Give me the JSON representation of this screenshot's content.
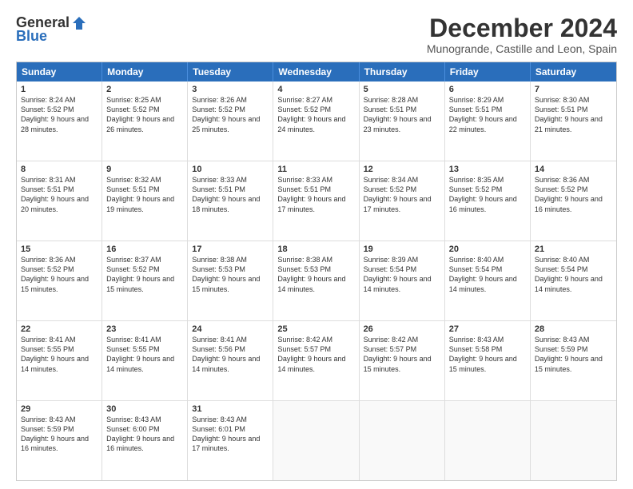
{
  "logo": {
    "general": "General",
    "blue": "Blue"
  },
  "title": "December 2024",
  "subtitle": "Munogrande, Castille and Leon, Spain",
  "days": [
    "Sunday",
    "Monday",
    "Tuesday",
    "Wednesday",
    "Thursday",
    "Friday",
    "Saturday"
  ],
  "weeks": [
    [
      {
        "day": "1",
        "sunrise": "Sunrise: 8:24 AM",
        "sunset": "Sunset: 5:52 PM",
        "daylight": "Daylight: 9 hours and 28 minutes."
      },
      {
        "day": "2",
        "sunrise": "Sunrise: 8:25 AM",
        "sunset": "Sunset: 5:52 PM",
        "daylight": "Daylight: 9 hours and 26 minutes."
      },
      {
        "day": "3",
        "sunrise": "Sunrise: 8:26 AM",
        "sunset": "Sunset: 5:52 PM",
        "daylight": "Daylight: 9 hours and 25 minutes."
      },
      {
        "day": "4",
        "sunrise": "Sunrise: 8:27 AM",
        "sunset": "Sunset: 5:52 PM",
        "daylight": "Daylight: 9 hours and 24 minutes."
      },
      {
        "day": "5",
        "sunrise": "Sunrise: 8:28 AM",
        "sunset": "Sunset: 5:51 PM",
        "daylight": "Daylight: 9 hours and 23 minutes."
      },
      {
        "day": "6",
        "sunrise": "Sunrise: 8:29 AM",
        "sunset": "Sunset: 5:51 PM",
        "daylight": "Daylight: 9 hours and 22 minutes."
      },
      {
        "day": "7",
        "sunrise": "Sunrise: 8:30 AM",
        "sunset": "Sunset: 5:51 PM",
        "daylight": "Daylight: 9 hours and 21 minutes."
      }
    ],
    [
      {
        "day": "8",
        "sunrise": "Sunrise: 8:31 AM",
        "sunset": "Sunset: 5:51 PM",
        "daylight": "Daylight: 9 hours and 20 minutes."
      },
      {
        "day": "9",
        "sunrise": "Sunrise: 8:32 AM",
        "sunset": "Sunset: 5:51 PM",
        "daylight": "Daylight: 9 hours and 19 minutes."
      },
      {
        "day": "10",
        "sunrise": "Sunrise: 8:33 AM",
        "sunset": "Sunset: 5:51 PM",
        "daylight": "Daylight: 9 hours and 18 minutes."
      },
      {
        "day": "11",
        "sunrise": "Sunrise: 8:33 AM",
        "sunset": "Sunset: 5:51 PM",
        "daylight": "Daylight: 9 hours and 17 minutes."
      },
      {
        "day": "12",
        "sunrise": "Sunrise: 8:34 AM",
        "sunset": "Sunset: 5:52 PM",
        "daylight": "Daylight: 9 hours and 17 minutes."
      },
      {
        "day": "13",
        "sunrise": "Sunrise: 8:35 AM",
        "sunset": "Sunset: 5:52 PM",
        "daylight": "Daylight: 9 hours and 16 minutes."
      },
      {
        "day": "14",
        "sunrise": "Sunrise: 8:36 AM",
        "sunset": "Sunset: 5:52 PM",
        "daylight": "Daylight: 9 hours and 16 minutes."
      }
    ],
    [
      {
        "day": "15",
        "sunrise": "Sunrise: 8:36 AM",
        "sunset": "Sunset: 5:52 PM",
        "daylight": "Daylight: 9 hours and 15 minutes."
      },
      {
        "day": "16",
        "sunrise": "Sunrise: 8:37 AM",
        "sunset": "Sunset: 5:52 PM",
        "daylight": "Daylight: 9 hours and 15 minutes."
      },
      {
        "day": "17",
        "sunrise": "Sunrise: 8:38 AM",
        "sunset": "Sunset: 5:53 PM",
        "daylight": "Daylight: 9 hours and 15 minutes."
      },
      {
        "day": "18",
        "sunrise": "Sunrise: 8:38 AM",
        "sunset": "Sunset: 5:53 PM",
        "daylight": "Daylight: 9 hours and 14 minutes."
      },
      {
        "day": "19",
        "sunrise": "Sunrise: 8:39 AM",
        "sunset": "Sunset: 5:54 PM",
        "daylight": "Daylight: 9 hours and 14 minutes."
      },
      {
        "day": "20",
        "sunrise": "Sunrise: 8:40 AM",
        "sunset": "Sunset: 5:54 PM",
        "daylight": "Daylight: 9 hours and 14 minutes."
      },
      {
        "day": "21",
        "sunrise": "Sunrise: 8:40 AM",
        "sunset": "Sunset: 5:54 PM",
        "daylight": "Daylight: 9 hours and 14 minutes."
      }
    ],
    [
      {
        "day": "22",
        "sunrise": "Sunrise: 8:41 AM",
        "sunset": "Sunset: 5:55 PM",
        "daylight": "Daylight: 9 hours and 14 minutes."
      },
      {
        "day": "23",
        "sunrise": "Sunrise: 8:41 AM",
        "sunset": "Sunset: 5:55 PM",
        "daylight": "Daylight: 9 hours and 14 minutes."
      },
      {
        "day": "24",
        "sunrise": "Sunrise: 8:41 AM",
        "sunset": "Sunset: 5:56 PM",
        "daylight": "Daylight: 9 hours and 14 minutes."
      },
      {
        "day": "25",
        "sunrise": "Sunrise: 8:42 AM",
        "sunset": "Sunset: 5:57 PM",
        "daylight": "Daylight: 9 hours and 14 minutes."
      },
      {
        "day": "26",
        "sunrise": "Sunrise: 8:42 AM",
        "sunset": "Sunset: 5:57 PM",
        "daylight": "Daylight: 9 hours and 15 minutes."
      },
      {
        "day": "27",
        "sunrise": "Sunrise: 8:43 AM",
        "sunset": "Sunset: 5:58 PM",
        "daylight": "Daylight: 9 hours and 15 minutes."
      },
      {
        "day": "28",
        "sunrise": "Sunrise: 8:43 AM",
        "sunset": "Sunset: 5:59 PM",
        "daylight": "Daylight: 9 hours and 15 minutes."
      }
    ],
    [
      {
        "day": "29",
        "sunrise": "Sunrise: 8:43 AM",
        "sunset": "Sunset: 5:59 PM",
        "daylight": "Daylight: 9 hours and 16 minutes."
      },
      {
        "day": "30",
        "sunrise": "Sunrise: 8:43 AM",
        "sunset": "Sunset: 6:00 PM",
        "daylight": "Daylight: 9 hours and 16 minutes."
      },
      {
        "day": "31",
        "sunrise": "Sunrise: 8:43 AM",
        "sunset": "Sunset: 6:01 PM",
        "daylight": "Daylight: 9 hours and 17 minutes."
      },
      null,
      null,
      null,
      null
    ]
  ]
}
